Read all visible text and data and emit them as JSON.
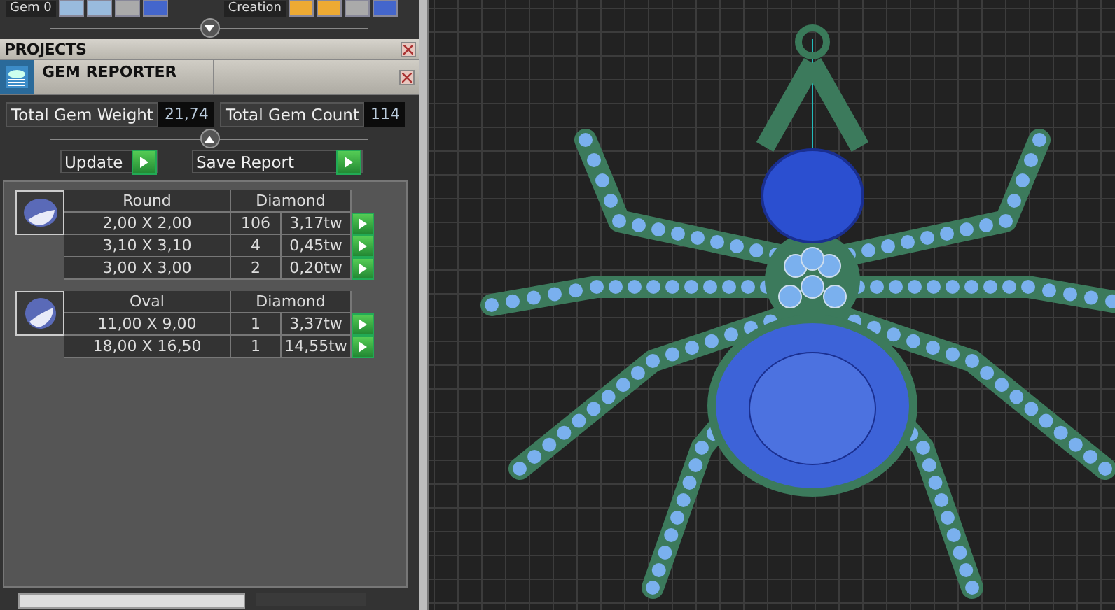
{
  "toolbar": [
    {
      "label": "Gem 0"
    },
    {
      "label": "Creation"
    }
  ],
  "projects": {
    "title": "PROJECTS"
  },
  "gem_reporter": {
    "title": "GEM REPORTER",
    "totals": [
      {
        "label": "Total Gem Weight",
        "value": "21,74"
      },
      {
        "label": "Total Gem Count",
        "value": "114"
      }
    ],
    "buttons": [
      "Update",
      "Save Report"
    ],
    "groups": [
      {
        "kind": "round",
        "shape": "Round",
        "material": "Diamond",
        "rows": [
          {
            "size": "2,00 X 2,00",
            "count": "106",
            "weight": "3,17tw"
          },
          {
            "size": "3,10 X 3,10",
            "count": "4",
            "weight": "0,45tw"
          },
          {
            "size": "3,00 X 3,00",
            "count": "2",
            "weight": "0,20tw"
          }
        ]
      },
      {
        "kind": "oval",
        "shape": "Oval",
        "material": "Diamond",
        "rows": [
          {
            "size": "11,00 X 9,00",
            "count": "1",
            "weight": "3,37tw"
          },
          {
            "size": "18,00 X 16,50",
            "count": "1",
            "weight": "14,55tw"
          }
        ]
      }
    ]
  }
}
